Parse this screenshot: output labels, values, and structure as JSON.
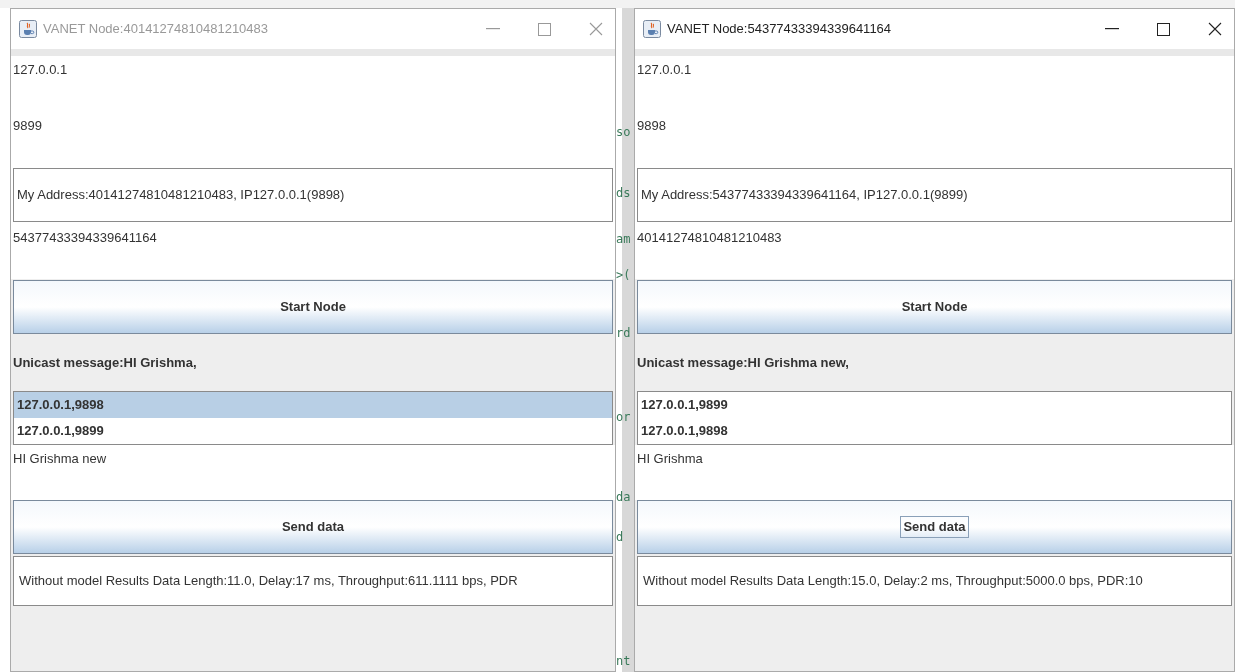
{
  "background_editor": {
    "fragments": [
      "so",
      "ds",
      "am",
      ">(",
      "rd",
      "or",
      "da",
      "d",
      "nt"
    ]
  },
  "windows": [
    {
      "title": "VANET Node:40141274810481210483",
      "active": false,
      "ip": "127.0.0.1",
      "port": "9899",
      "my_address": "My Address:40141274810481210483, IP127.0.0.1(9898)",
      "peer_address": "54377433394339641164",
      "start_button": "Start Node",
      "unicast_label": "Unicast message:HI Grishma,",
      "peers": [
        {
          "label": "127.0.0.1,9898",
          "selected": true
        },
        {
          "label": "127.0.0.1,9899",
          "selected": false
        }
      ],
      "message": "HI Grishma new",
      "send_button": {
        "label": "Send data",
        "focused": false
      },
      "results": "Without model Results Data Length:11.0, Delay:17 ms, Throughput:611.1111 bps, PDR"
    },
    {
      "title": "VANET Node:54377433394339641164",
      "active": true,
      "ip": "127.0.0.1",
      "port": "9898",
      "my_address": "My Address:54377433394339641164, IP127.0.0.1(9899)",
      "peer_address": "40141274810481210483",
      "start_button": "Start Node",
      "unicast_label": "Unicast message:HI Grishma new,",
      "peers": [
        {
          "label": "127.0.0.1,9899",
          "selected": false
        },
        {
          "label": "127.0.0.1,9898",
          "selected": false
        }
      ],
      "message": "HI Grishma",
      "send_button": {
        "label": "Send data",
        "focused": true
      },
      "results": "Without model Results Data Length:15.0, Delay:2 ms, Throughput:5000.0 bps, PDR:10"
    }
  ]
}
